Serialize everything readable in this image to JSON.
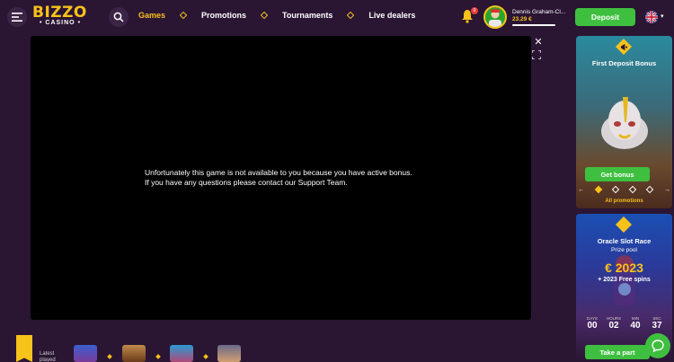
{
  "header": {
    "logo_main": "BIZZO",
    "logo_sub": "• CASINO •",
    "nav": [
      {
        "label": "Games",
        "active": true
      },
      {
        "label": "Promotions",
        "active": false
      },
      {
        "label": "Tournaments",
        "active": false
      },
      {
        "label": "Live dealers",
        "active": false
      }
    ],
    "notifications_count": "0",
    "user_name": "Dennis Graham-Cl...",
    "user_balance": "23.29 €",
    "deposit_label": "Deposit",
    "language": "EN (UK flag)"
  },
  "game": {
    "message_line1": "Unfortunately this game is not available to you because you have active bonus.",
    "message_line2": "If you have any questions please contact our Support Team."
  },
  "promo1": {
    "title": "First Deposit Bonus",
    "button": "Get bonus",
    "prev": "←",
    "next": "→",
    "all_promotions": "All promotions"
  },
  "promo2": {
    "title": "Oracle Slot Race",
    "subtitle": "Prize pool",
    "amount": "€ 2023",
    "spins": "+ 2023 Free spins",
    "countdown": [
      {
        "label": "DAYS",
        "value": "00"
      },
      {
        "label": "HOURS",
        "value": "02"
      },
      {
        "label": "MIN",
        "value": "40"
      },
      {
        "label": "SEC",
        "value": "37"
      }
    ],
    "button": "Take a part"
  },
  "latest": {
    "label_line1": "Latest",
    "label_line2": "played"
  },
  "colors": {
    "background": "#2a1533",
    "accent": "#f6c21b",
    "button_green": "#3fbf3f"
  }
}
